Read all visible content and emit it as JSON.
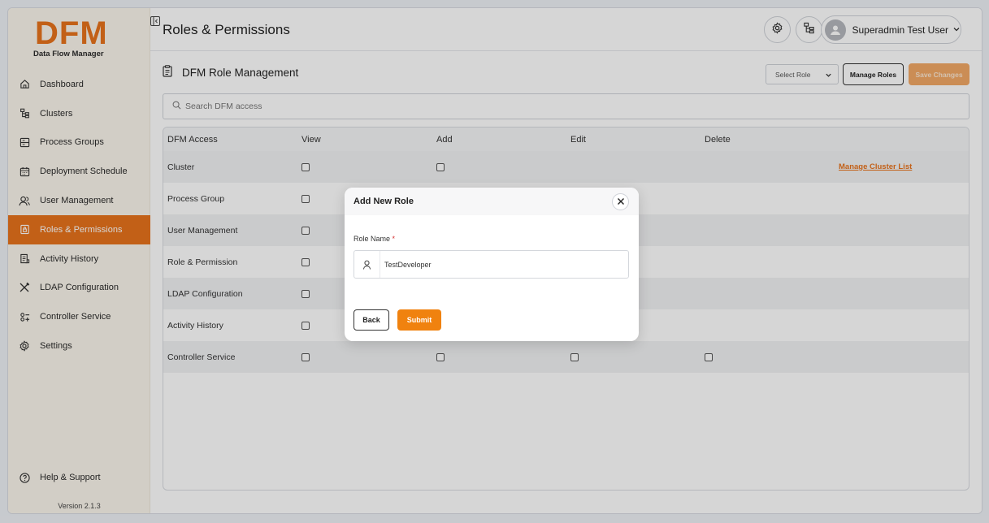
{
  "brand": {
    "logo_text": "DFM",
    "subtitle": "Data Flow Manager",
    "accent": "#e8731c"
  },
  "sidebar": {
    "items": [
      {
        "label": "Dashboard",
        "icon": "home-icon"
      },
      {
        "label": "Clusters",
        "icon": "cluster-icon"
      },
      {
        "label": "Process Groups",
        "icon": "process-groups-icon"
      },
      {
        "label": "Deployment Schedule",
        "icon": "calendar-icon"
      },
      {
        "label": "User Management",
        "icon": "users-icon"
      },
      {
        "label": "Roles & Permissions",
        "icon": "lock-document-icon",
        "active": true
      },
      {
        "label": "Activity History",
        "icon": "history-icon"
      },
      {
        "label": "LDAP Configuration",
        "icon": "tools-icon"
      },
      {
        "label": "Controller Service",
        "icon": "controller-icon"
      },
      {
        "label": "Settings",
        "icon": "gear-icon"
      }
    ],
    "help_label": "Help & Support",
    "version": "Version 2.1.3"
  },
  "header": {
    "title": "Roles & Permissions",
    "user_name": "Superadmin Test User"
  },
  "main": {
    "section_title": "DFM Role Management",
    "select_role": "Select Role",
    "manage_roles": "Manage Roles",
    "save_changes": "Save Changes",
    "search_placeholder": "Search DFM access",
    "columns": [
      "DFM Access",
      "View",
      "Add",
      "Edit",
      "Delete"
    ],
    "rows": [
      {
        "name": "Cluster",
        "view": true,
        "add": true,
        "edit": false,
        "delete": false,
        "link": "Manage Cluster List"
      },
      {
        "name": "Process Group",
        "view": true,
        "add": false,
        "edit": false,
        "delete": false
      },
      {
        "name": "User Management",
        "view": true,
        "add": false,
        "edit": false,
        "delete": false
      },
      {
        "name": "Role & Permission",
        "view": true,
        "add": false,
        "edit": false,
        "delete": false
      },
      {
        "name": "LDAP Configuration",
        "view": true,
        "add": false,
        "edit": false,
        "delete": false
      },
      {
        "name": "Activity History",
        "view": true,
        "add": false,
        "edit": false,
        "delete": false
      },
      {
        "name": "Controller Service",
        "view": true,
        "add": true,
        "edit": true,
        "delete": true
      }
    ]
  },
  "modal": {
    "title": "Add New Role",
    "field_label": "Role Name",
    "required_mark": "*",
    "field_value": "TestDeveloper",
    "back_label": "Back",
    "submit_label": "Submit"
  }
}
